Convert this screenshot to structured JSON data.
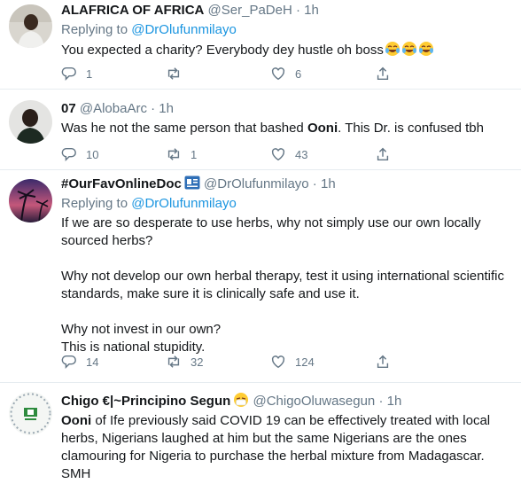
{
  "tweets": [
    {
      "name": "ALAFRICA OF AFRICA",
      "handle": "@Ser_PaDeH",
      "sep": " · ",
      "time": "1h",
      "reply_prefix": "Replying to ",
      "reply_handle": "@DrOlufunmilayo",
      "text": "You expected a charity? Everybody dey hustle oh boss",
      "emoji": [
        "face-with-tears-of-joy",
        "face-with-tears-of-joy",
        "face-with-tears-of-joy"
      ],
      "counts": {
        "reply": "1",
        "retweet": "",
        "like": "6"
      }
    },
    {
      "name": "07",
      "handle": "@AlobaArc",
      "sep": " · ",
      "time": "1h",
      "text_before": "Was he not the same person that bashed ",
      "text_bold": "Ooni",
      "text_after": ". This Dr. is confused tbh",
      "counts": {
        "reply": "10",
        "retweet": "1",
        "like": "43"
      }
    },
    {
      "name": "#OurFavOnlineDoc",
      "badge": "id-card-icon",
      "handle": "@DrOlufunmilayo",
      "sep": " · ",
      "time": "1h",
      "reply_prefix": "Replying to ",
      "reply_handle": "@DrOlufunmilayo",
      "text": "If we are so desperate to use herbs, why not simply use our own locally sourced herbs?\n\nWhy not develop our own herbal therapy, test it using international scientific standards, make sure it is clinically safe and use it.\n\nWhy not invest in our own?\nThis is national stupidity.",
      "counts": {
        "reply": "14",
        "retweet": "32",
        "like": "124"
      }
    },
    {
      "name": "Chigo €|~Principino Segun",
      "emoji": "face-with-medical-mask",
      "handle": "@ChigoOluwasegun",
      "sep": " · ",
      "time": "1h",
      "text_bold": "Ooni",
      "text_after": " of Ife previously said COVID 19 can be effectively treated with local herbs, Nigerians laughed at him but the same Nigerians are the ones clamouring for Nigeria to purchase the herbal mixture from Madagascar. SMH"
    }
  ],
  "colors": {
    "link": "#1b95e0",
    "secondary": "#657786",
    "border": "#e6ecf0"
  }
}
